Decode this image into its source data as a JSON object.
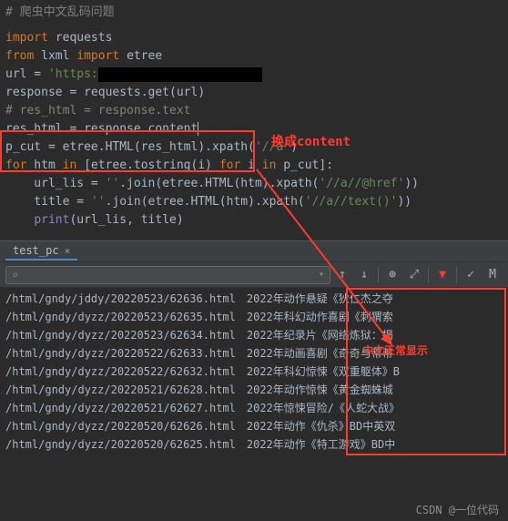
{
  "code": {
    "l1": "# 爬虫中文乱码问题",
    "l2_import": "import",
    "l2_mod": " requests",
    "l3_from": "from",
    "l3_mid": " lxml ",
    "l3_import": "import",
    "l3_mod": " etree",
    "l4_a": "url = ",
    "l4_b": "'https:",
    "l5": "response = requests.get(url)",
    "l6": "# res_html = response.text",
    "l7": "res_html = response.content",
    "l8_a": "p_cut = etree.HTML(res_html).xpath(",
    "l8_b": "'//a'",
    "l8_c": ")",
    "l9_for": "for",
    "l9_mid": " htm ",
    "l9_in": "in",
    "l9_b": " [etree.tostring(i) ",
    "l9_for2": "for",
    "l9_mid2": " i ",
    "l9_in2": "in",
    "l9_c": " p_cut]:",
    "l10_a": "    url_lis = ",
    "l10_b": "''",
    "l10_c": ".join(etree.HTML(htm).xpath(",
    "l10_d": "'//a//@href'",
    "l10_e": "))",
    "l11_a": "    title = ",
    "l11_b": "''",
    "l11_c": ".join(etree.HTML(htm).xpath(",
    "l11_d": "'//a//text()'",
    "l11_e": "))",
    "l12_a": "    ",
    "l12_b": "print",
    "l12_c": "(url_lis, title)"
  },
  "annotations": {
    "a1": "换成content",
    "a2": "中文正常显示"
  },
  "tab": {
    "name": "test_pc",
    "close": "×"
  },
  "toolbar": {
    "search_placeholder": "",
    "check": "✓",
    "m": "M"
  },
  "output": {
    "left": [
      "/html/gndy/jddy/20220523/62636.html",
      "/html/gndy/dyzz/20220523/62635.html",
      "/html/gndy/dyzz/20220523/62634.html",
      "/html/gndy/dyzz/20220522/62633.html",
      "/html/gndy/dyzz/20220522/62632.html",
      "/html/gndy/dyzz/20220521/62628.html",
      "/html/gndy/dyzz/20220521/62627.html",
      "/html/gndy/dyzz/20220520/62626.html",
      "/html/gndy/dyzz/20220520/62625.html"
    ],
    "right": [
      "2022年动作悬疑《狄仁杰之夺",
      "2022年科幻动作喜剧《刺猬索",
      "2022年纪录片《网络炼狱：揭",
      "2022年动画喜剧《奇奇与蒂蒂",
      "2022年科幻惊悚《双重躯体》B",
      "2022年动作惊悚《黄金蜘蛛城",
      "2022年惊悚冒险/《人蛇大战》",
      "2022年动作《仇杀》BD中英双",
      "2022年动作《特工游戏》BD中"
    ]
  },
  "watermark": "CSDN @一位代码"
}
